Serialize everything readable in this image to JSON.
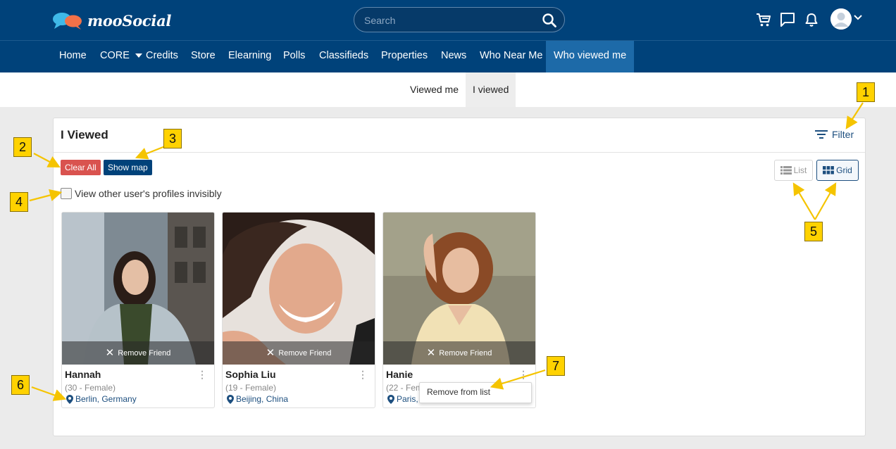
{
  "header": {
    "logo_text": "mooSocial",
    "search_placeholder": "Search",
    "icons": [
      "cart-icon",
      "chat-icon",
      "bell-icon",
      "user-avatar-icon",
      "chevron-down-icon"
    ]
  },
  "nav": {
    "items": [
      "Home",
      "CORE",
      "Credits",
      "Store",
      "Elearning",
      "Polls",
      "Classifieds",
      "Properties",
      "News",
      "Who Near Me",
      "Who viewed me"
    ],
    "active": "Who viewed me"
  },
  "subtabs": {
    "items": [
      "Viewed me",
      "I viewed"
    ],
    "active": "I viewed"
  },
  "panel": {
    "title": "I Viewed",
    "filter_label": "Filter",
    "clear_all_label": "Clear All",
    "show_map_label": "Show map",
    "list_label": "List",
    "grid_label": "Grid",
    "view_mode": "Grid",
    "invisible_label": "View other user's profiles invisibly",
    "invisible_checked": false
  },
  "users": [
    {
      "name": "Hannah",
      "age_gender": "(30 - Female)",
      "location": "Berlin, Germany",
      "remove_label": "Remove Friend"
    },
    {
      "name": "Sophia Liu",
      "age_gender": "(19 - Female)",
      "location": "Beijing, China",
      "remove_label": "Remove Friend"
    },
    {
      "name": "Hanie",
      "age_gender": "(22 - Fem",
      "location": "Paris,",
      "remove_label": "Remove Friend"
    }
  ],
  "context_menu": {
    "item": "Remove from list"
  },
  "annotations": [
    "1",
    "2",
    "3",
    "4",
    "5",
    "6",
    "7"
  ],
  "colors": {
    "header_bg": "#00427a",
    "nav_active_bg": "#1d6aa8",
    "clear_button": "#d9534f",
    "link_blue": "#1d4f7f",
    "annotation_yellow": "#ffd200"
  }
}
